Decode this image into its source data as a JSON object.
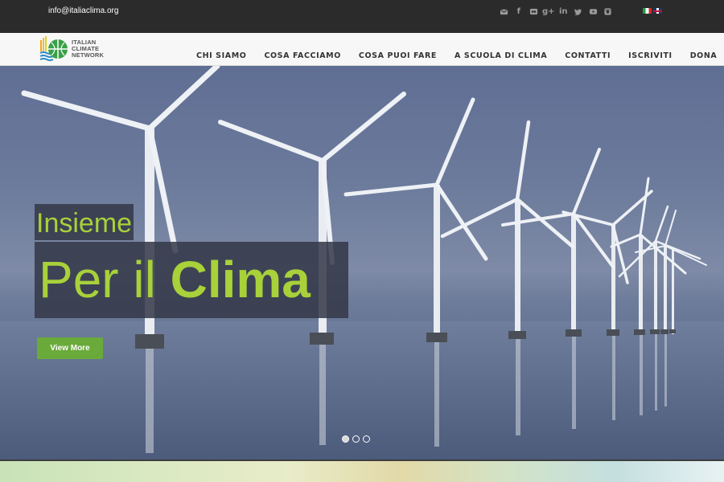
{
  "topbar": {
    "email": "info@italiaclima.org",
    "socials": [
      {
        "icon": "email-icon"
      },
      {
        "icon": "facebook-icon",
        "glyph": "f"
      },
      {
        "icon": "flickr-icon"
      },
      {
        "icon": "google-plus-icon",
        "glyph": "g+"
      },
      {
        "icon": "linkedin-icon",
        "glyph": "in"
      },
      {
        "icon": "twitter-icon"
      },
      {
        "icon": "youtube-icon"
      },
      {
        "icon": "instagram-icon"
      }
    ],
    "languages": [
      "it",
      "en"
    ]
  },
  "header": {
    "logo_lines": [
      "ITALIAN",
      "CLIMATE",
      "NETWORK"
    ],
    "nav": [
      "CHI SIAMO",
      "COSA FACCIAMO",
      "COSA PUOI FARE",
      "A SCUOLA DI CLIMA",
      "CONTATTI",
      "ISCRIVITI",
      "DONA"
    ]
  },
  "hero": {
    "line1": "Insieme",
    "line2_light": "Per il ",
    "line2_bold": "Clima",
    "button": "View More",
    "slides": 3,
    "active_slide": 1
  },
  "colors": {
    "accent_green": "#a8d13a",
    "button_green": "#6aaa3a",
    "topbar_bg": "#2b2b2b",
    "nav_bg": "#f7f7f7"
  }
}
